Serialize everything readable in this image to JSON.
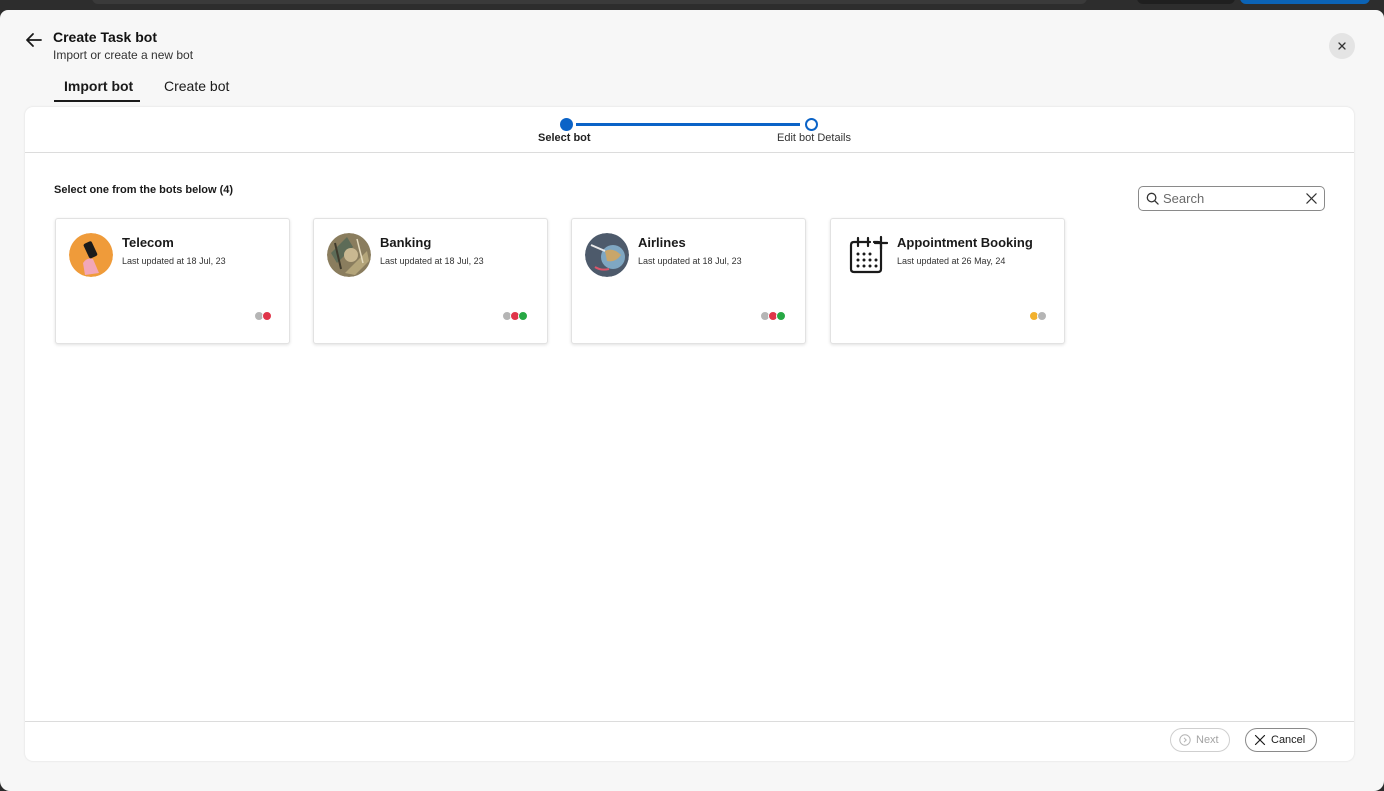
{
  "header": {
    "title": "Create Task bot",
    "subtitle": "Import or create a new bot"
  },
  "tabs": [
    {
      "label": "Import bot",
      "active": true
    },
    {
      "label": "Create bot",
      "active": false
    }
  ],
  "stepper": {
    "steps": [
      {
        "label": "Select bot",
        "state": "current"
      },
      {
        "label": "Edit bot Details",
        "state": "upcoming"
      }
    ]
  },
  "main": {
    "heading": "Select one from the bots below (4)",
    "search": {
      "placeholder": "Search",
      "value": ""
    }
  },
  "bots": [
    {
      "name": "Telecom",
      "updated": "Last updated at 18 Jul, 23",
      "avatar": "telecom-avatar",
      "channels": [
        "grey",
        "red"
      ]
    },
    {
      "name": "Banking",
      "updated": "Last updated at 18 Jul, 23",
      "avatar": "banking-avatar",
      "channels": [
        "grey",
        "red",
        "green"
      ]
    },
    {
      "name": "Airlines",
      "updated": "Last updated at 18 Jul, 23",
      "avatar": "airlines-avatar",
      "channels": [
        "grey",
        "red",
        "green"
      ]
    },
    {
      "name": "Appointment Booking",
      "updated": "Last updated at 26 May, 24",
      "avatar": "calendar-plus-icon",
      "channels": [
        "yellow",
        "grey"
      ]
    }
  ],
  "footer": {
    "next_label": "Next",
    "cancel_label": "Cancel"
  },
  "colors": {
    "accent": "#0b63c7",
    "channel_red": "#e0354a",
    "channel_green": "#27a844",
    "channel_yellow": "#f2b12e"
  }
}
